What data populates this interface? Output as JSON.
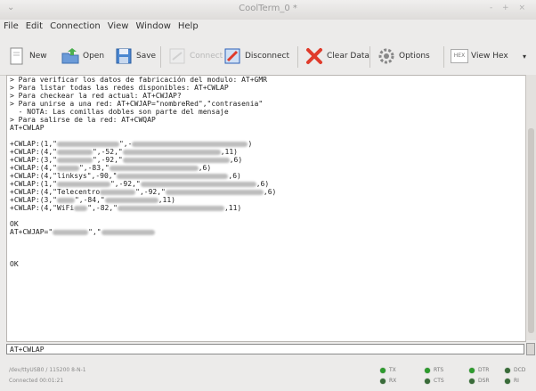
{
  "window": {
    "title": "CoolTerm_0 *",
    "sysmenu": "⌄",
    "controls": "‑ + ×"
  },
  "menu": [
    "File",
    "Edit",
    "Connection",
    "View",
    "Window",
    "Help"
  ],
  "toolbar": {
    "new": "New",
    "open": "Open",
    "save": "Save",
    "connect": "Connect",
    "disconnect": "Disconnect",
    "clear": "Clear Data",
    "options": "Options",
    "hex_badge": "HEX",
    "viewhex": "View Hex",
    "more": "▾"
  },
  "terminal_lines": [
    "> Para verificar los datos de fabricación del modulo: AT+GMR",
    "> Para listar todas las redes disponibles: AT+CWLAP",
    "> Para checkear la red actual: AT+CWJAP?",
    "> Para unirse a una red: AT+CWJAP=\"nombreRed\",\"contrasenia\"",
    "  - NOTA: Las comillas dobles son parte del mensaje",
    "> Para salirse de la red: AT+CWQAP",
    "AT+CWLAP",
    "",
    "+CWLAP:(1,\"",
    "+CWLAP:(4,\"",
    "+CWLAP:(3,\"",
    "+CWLAP:(4,\"",
    "+CWLAP:(4,\"linksys\",-90,\"",
    "+CWLAP:(1,\"",
    "+CWLAP:(4,\"Telecentro",
    "+CWLAP:(3,\"",
    "+CWLAP:(4,\"WiFi",
    "",
    "OK",
    "AT+CWJAP=\"",
    "",
    "",
    "",
    "OK"
  ],
  "terminal_fragments": [
    "\",-",
    ")",
    "\",-52,\"",
    ",11)",
    "\",-92,\"",
    ",6)",
    "\",-83,\"",
    ",6)",
    ",6)",
    "\",-92,\"",
    ",6)",
    "\",-92,\"",
    ",6)",
    "\",-84,\"",
    ",11)",
    "\",-82,\"",
    ",11)",
    "\",\""
  ],
  "input": {
    "value": "AT+CWLAP"
  },
  "status": {
    "port": "/dev/ttyUSB0 / 115200 8-N-1",
    "connected": "Connected 00:01:21",
    "leds": [
      {
        "label": "TX",
        "on": true
      },
      {
        "label": "RTS",
        "on": true
      },
      {
        "label": "DTR",
        "on": true
      },
      {
        "label": "DCD",
        "on": false
      },
      {
        "label": "RX",
        "on": false
      },
      {
        "label": "CTS",
        "on": false
      },
      {
        "label": "DSR",
        "on": false
      },
      {
        "label": "RI",
        "on": false
      }
    ]
  },
  "colors": {
    "led_on": "#2e9b2e",
    "led_off": "#3a6b3a",
    "disconnect": "#2b5fb8",
    "clear_x": "#e03b2b"
  }
}
